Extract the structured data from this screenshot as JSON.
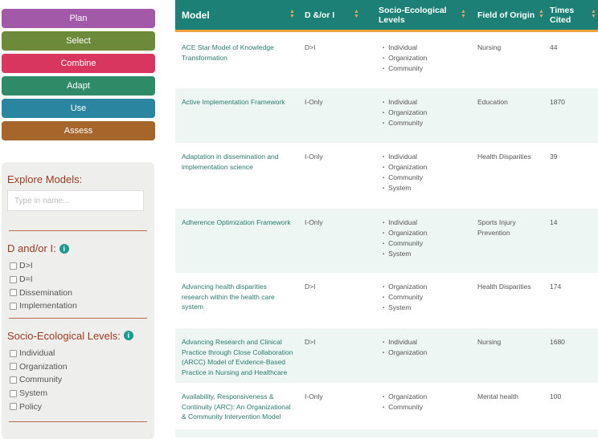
{
  "buttons": [
    {
      "label": "Plan",
      "color": "#a25aa8"
    },
    {
      "label": "Select",
      "color": "#6c8a3a"
    },
    {
      "label": "Combine",
      "color": "#d8365e"
    },
    {
      "label": "Adapt",
      "color": "#2f8a68"
    },
    {
      "label": "Use",
      "color": "#2a85a0"
    },
    {
      "label": "Assess",
      "color": "#a5652b"
    }
  ],
  "filters": {
    "explore_title": "Explore Models:",
    "search_placeholder": "Type in name...",
    "di_title": "D and/or I:",
    "di_options": [
      "D>I",
      "D=I",
      "Dissemination",
      "Implementation"
    ],
    "sel_title": "Socio-Ecological Levels:",
    "sel_options": [
      "Individual",
      "Organization",
      "Community",
      "System",
      "Policy"
    ]
  },
  "table": {
    "headers": [
      "Model",
      "D &/or I",
      "Socio-Ecological Levels",
      "Field of Origin",
      "Times Cited"
    ],
    "rows": [
      {
        "model": "ACE Star Model of Knowledge Transformation",
        "di": "D>I",
        "levels": [
          "Individual",
          "Organization",
          "Community"
        ],
        "field": "Nursing",
        "cited": "44"
      },
      {
        "model": "Active Implementation Framework",
        "di": "I-Only",
        "levels": [
          "Individual",
          "Organization",
          "Community"
        ],
        "field": "Education",
        "cited": "1870"
      },
      {
        "model": "Adaptation in dissemination and implementation science",
        "di": "I-Only",
        "levels": [
          "Individual",
          "Organization",
          "Community",
          "System"
        ],
        "field": "Health Disparities",
        "cited": "39"
      },
      {
        "model": "Adherence Optimization Framework",
        "di": "I-Only",
        "levels": [
          "Individual",
          "Organization",
          "Community",
          "System"
        ],
        "field": "Sports Injury Prevention",
        "cited": "14"
      },
      {
        "model": "Advancing health disparities research within the health care system",
        "di": "D>I",
        "levels": [
          "Organization",
          "Community",
          "System"
        ],
        "field": "Health Disparities",
        "cited": "174"
      },
      {
        "model": "Advancing Research and Clinical Practice through Close Collaboration (ARCC) Model of Evidence-Based Practice in Nursing and Healthcare",
        "di": "D>I",
        "levels": [
          "Individual",
          "Organization"
        ],
        "field": "Nursing",
        "cited": "1680"
      },
      {
        "model": "Availability, Responsiveness & Continuity (ARC): An Organizational & Community Intervention Model",
        "di": "I-Only",
        "levels": [
          "Organization",
          "Community"
        ],
        "field": "Mental health",
        "cited": "100"
      }
    ]
  }
}
